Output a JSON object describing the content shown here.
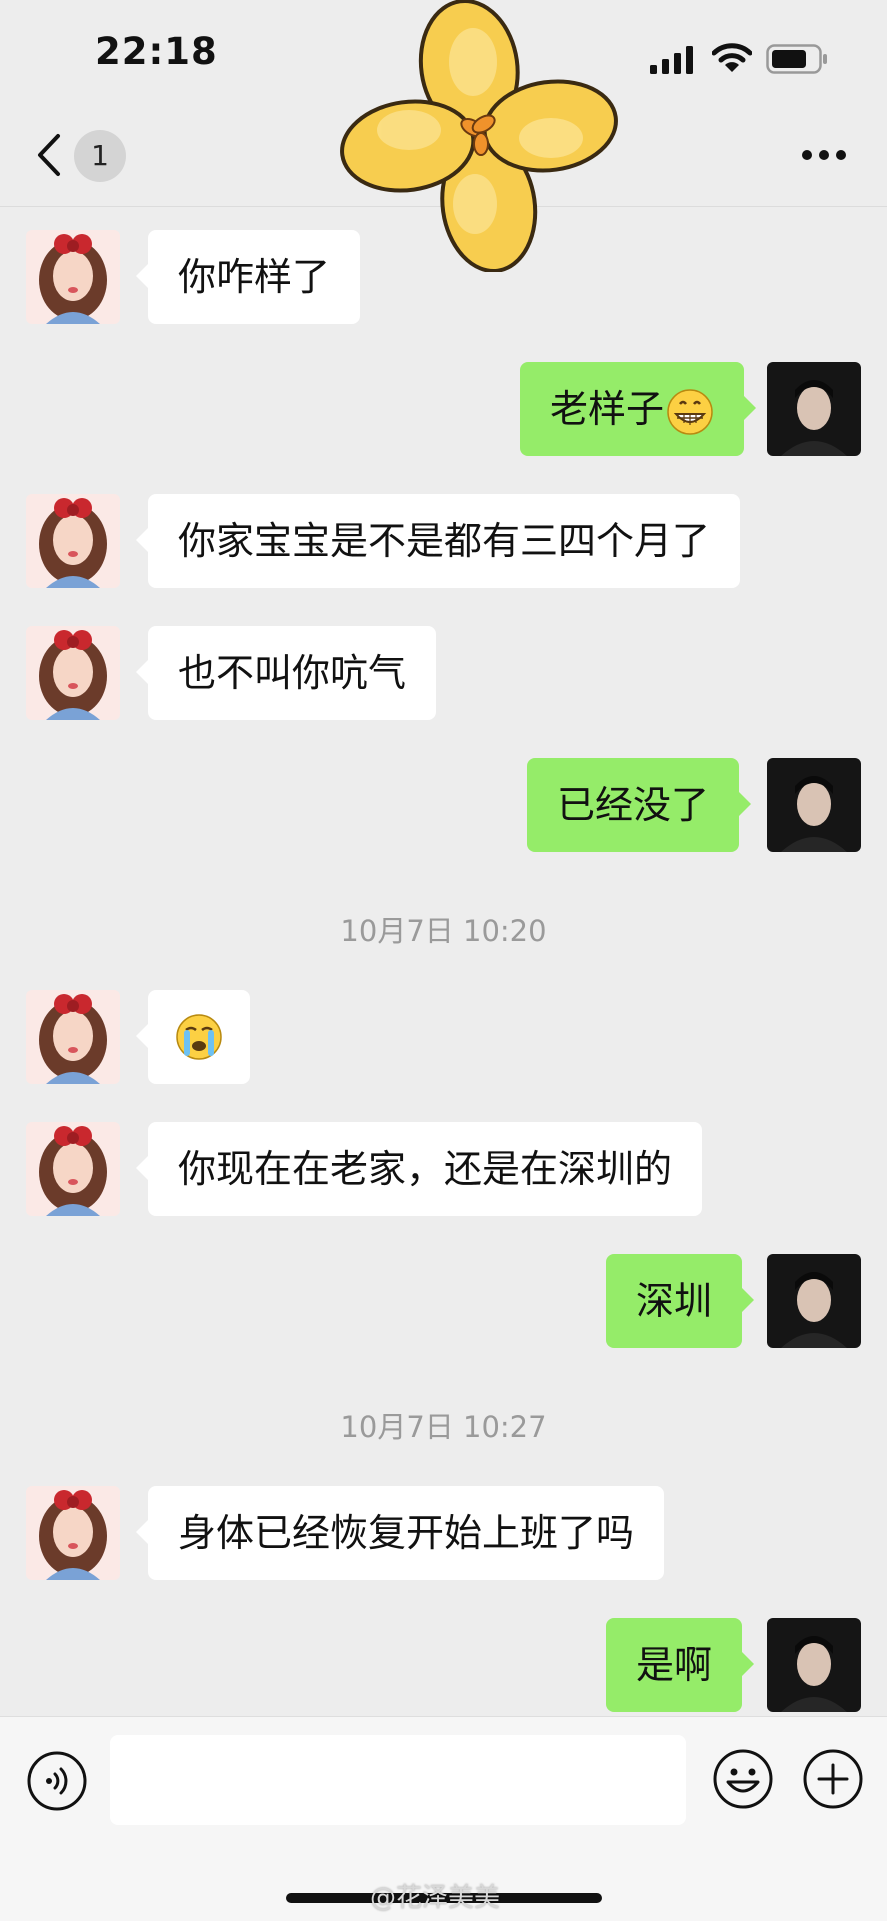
{
  "status": {
    "time": "22:18"
  },
  "nav": {
    "unread_count": "1"
  },
  "messages": [
    {
      "dir": "in",
      "text": "你咋样了"
    },
    {
      "dir": "out",
      "text": "老样子"
    },
    {
      "dir": "in",
      "text": "你家宝宝是不是都有三四个月了"
    },
    {
      "dir": "in",
      "text": "也不叫你吭气"
    },
    {
      "dir": "out",
      "text": "已经没了"
    },
    {
      "dir": "in",
      "text": ""
    },
    {
      "dir": "in",
      "text": "你现在在老家，还是在深圳的"
    },
    {
      "dir": "out",
      "text": "深圳"
    },
    {
      "dir": "in",
      "text": "身体已经恢复开始上班了吗"
    },
    {
      "dir": "out",
      "text": "是啊"
    }
  ],
  "timestamps": [
    "10月7日 10:20",
    "10月7日 10:27"
  ],
  "input": {
    "value": ""
  },
  "watermark": "@花泽美美",
  "colors": {
    "background": "#ededed",
    "incoming_bubble": "#ffffff",
    "outgoing_bubble": "#95ec69"
  },
  "icons": [
    "back-chevron-icon",
    "more-icon",
    "voice-icon",
    "emoji-icon",
    "plus-icon",
    "grin-emoji",
    "cry-emoji"
  ]
}
